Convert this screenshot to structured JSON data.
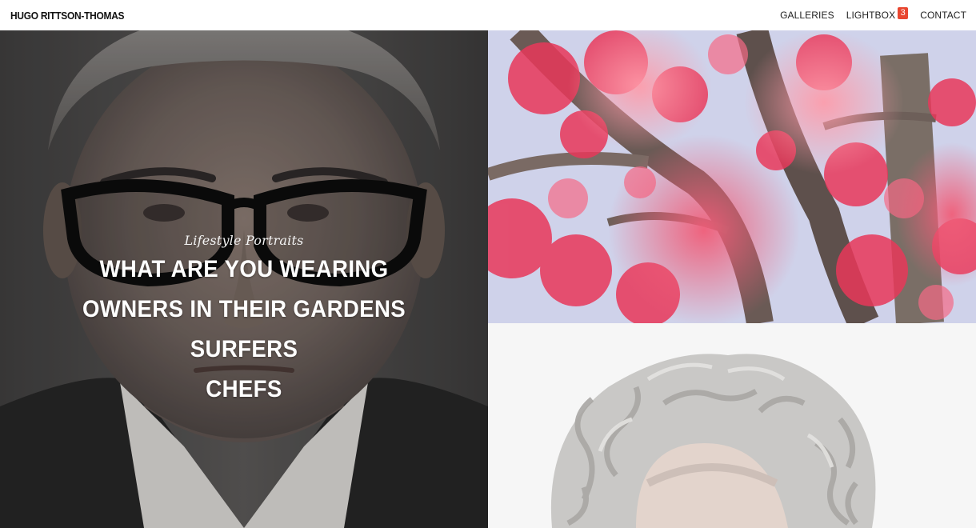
{
  "header": {
    "logo": "HUGO RITTSON-THOMAS",
    "nav": [
      {
        "label": "GALLERIES"
      },
      {
        "label": "LIGHTBOX",
        "badge": "3"
      },
      {
        "label": "CONTACT"
      }
    ]
  },
  "hero": {
    "subtitle": "Lifestyle Portraits",
    "items": [
      "WHAT ARE YOU WEARING",
      "OWNERS IN THEIR GARDENS",
      "SURFERS",
      "CHEFS"
    ]
  },
  "colors": {
    "badge": "#e8462f",
    "maple_red": "#e8385a",
    "sky": "#c9cde6"
  }
}
